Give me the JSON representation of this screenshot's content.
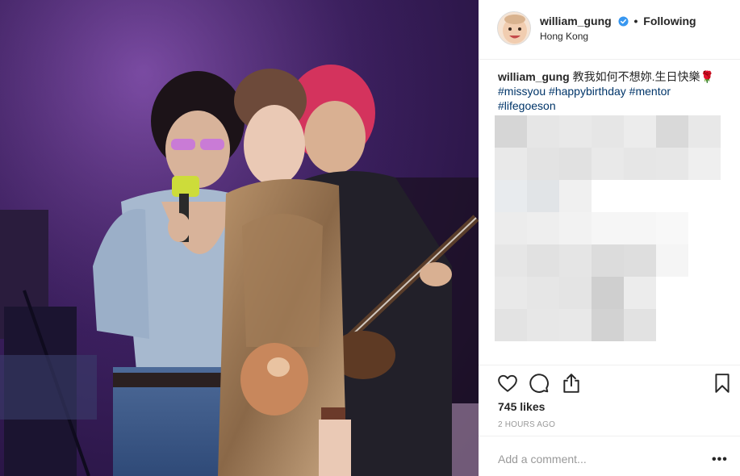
{
  "post": {
    "username": "william_gung",
    "follow_separator": "•",
    "follow_status": "Following",
    "location": "Hong Kong"
  },
  "caption": {
    "username": "william_gung",
    "text": " 教我如何不想妳.生日快樂🌹",
    "hashtags": [
      "#missyou",
      "#happybirthday",
      "#mentor",
      "#lifegoeson"
    ]
  },
  "engagement": {
    "likes": "745 likes",
    "timestamp": "2 HOURS AGO"
  },
  "comment": {
    "placeholder": "Add a comment...",
    "more_label": "•••"
  },
  "icons": {
    "avatar": "baby-avatar",
    "verified": "verified-badge-icon",
    "like": "heart-icon",
    "comment": "comment-icon",
    "share": "share-icon",
    "save": "bookmark-icon"
  },
  "colors": {
    "verified": "#3897f0",
    "hashtag": "#003569",
    "secondary_text": "#999999",
    "divider": "#efefef"
  }
}
